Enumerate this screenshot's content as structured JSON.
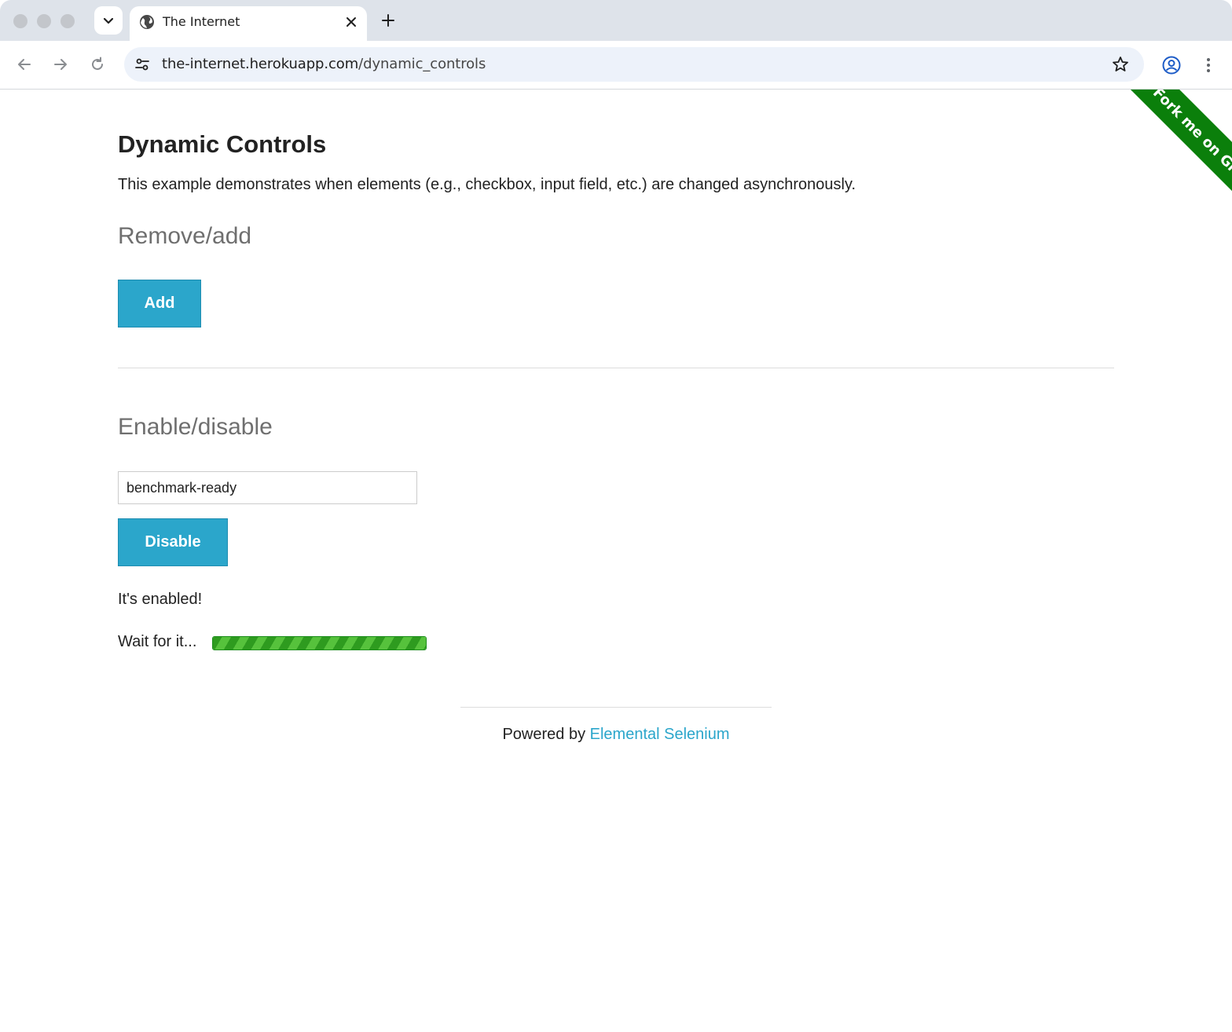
{
  "browser": {
    "tab_title": "The Internet",
    "url_host": "the-internet.herokuapp.com",
    "url_path": "/dynamic_controls"
  },
  "ribbon": {
    "label": "Fork me on GitHub",
    "color": "#0b7f0b"
  },
  "page": {
    "title": "Dynamic Controls",
    "description": "This example demonstrates when elements (e.g., checkbox, input field, etc.) are changed asynchronously.",
    "remove_add": {
      "heading": "Remove/add",
      "button_label": "Add"
    },
    "enable_disable": {
      "heading": "Enable/disable",
      "input_value": "benchmark-ready",
      "button_label": "Disable",
      "message": "It's enabled!",
      "loading_label": "Wait for it...",
      "progress_percent": 100
    },
    "footer": {
      "prefix": "Powered by ",
      "link_label": "Elemental Selenium"
    }
  },
  "colors": {
    "accent": "#2ba6cb",
    "progress_green": "#3fae2a"
  },
  "icons": {
    "tab_favicon": "globe-icon",
    "site_info": "tune-icon",
    "bookmark": "star-icon",
    "profile": "account-icon",
    "menu": "kebab-menu-icon"
  }
}
